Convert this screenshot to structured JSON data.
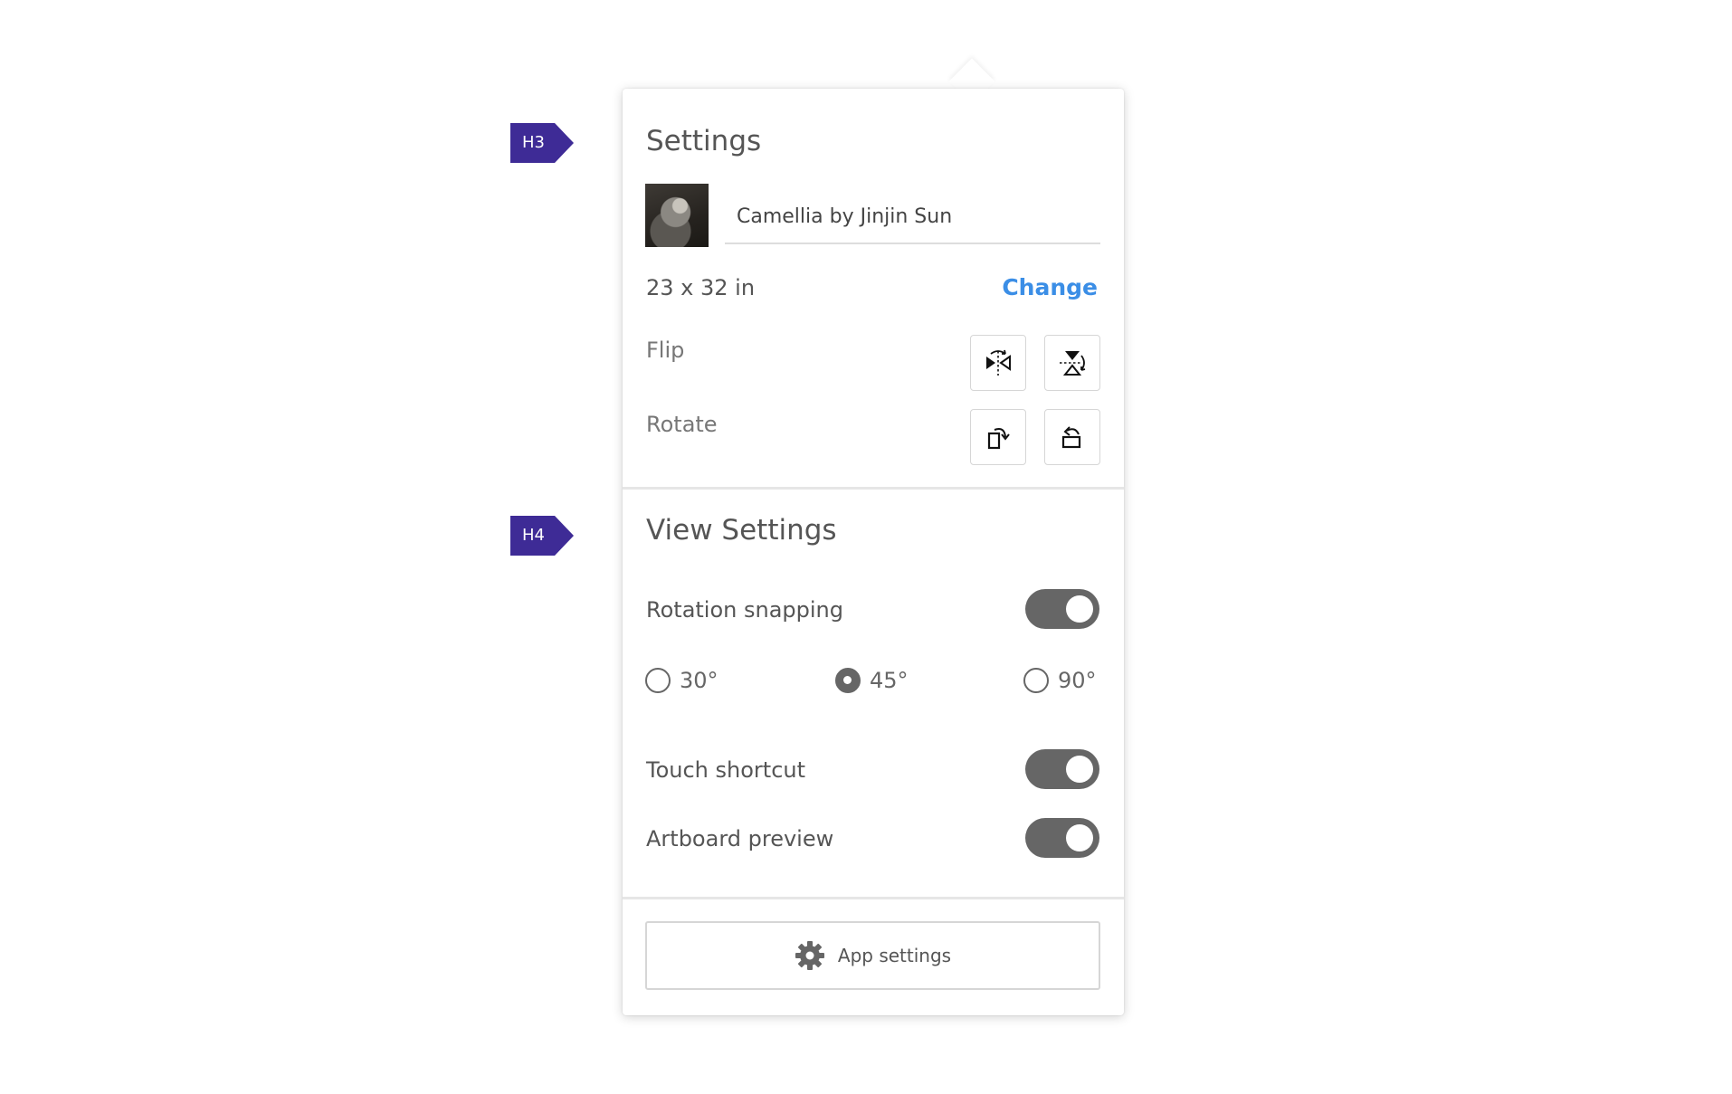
{
  "tags": {
    "h3": "H3",
    "h4": "H4"
  },
  "settings": {
    "title": "Settings",
    "artwork_name": "Camellia by Jinjin Sun",
    "size": "23 x 32 in",
    "change_label": "Change",
    "flip_label": "Flip",
    "rotate_label": "Rotate",
    "icons": {
      "flip_horizontal": "flip-horizontal-icon",
      "flip_vertical": "flip-vertical-icon",
      "rotate_cw": "rotate-clockwise-icon",
      "rotate_ccw": "rotate-counterclockwise-icon"
    }
  },
  "view_settings": {
    "title": "View Settings",
    "rotation_snapping": {
      "label": "Rotation snapping",
      "on": true
    },
    "snap_options": [
      {
        "label": "30°",
        "selected": false
      },
      {
        "label": "45°",
        "selected": true
      },
      {
        "label": "90°",
        "selected": false
      }
    ],
    "touch_shortcut": {
      "label": "Touch shortcut",
      "on": true
    },
    "artboard_preview": {
      "label": "Artboard preview",
      "on": true
    }
  },
  "footer": {
    "app_settings_label": "App settings",
    "icon": "gear-icon"
  },
  "colors": {
    "accent": "#3b8ee6",
    "tag_bg": "#3e2b96",
    "toggle_on": "#666666"
  }
}
